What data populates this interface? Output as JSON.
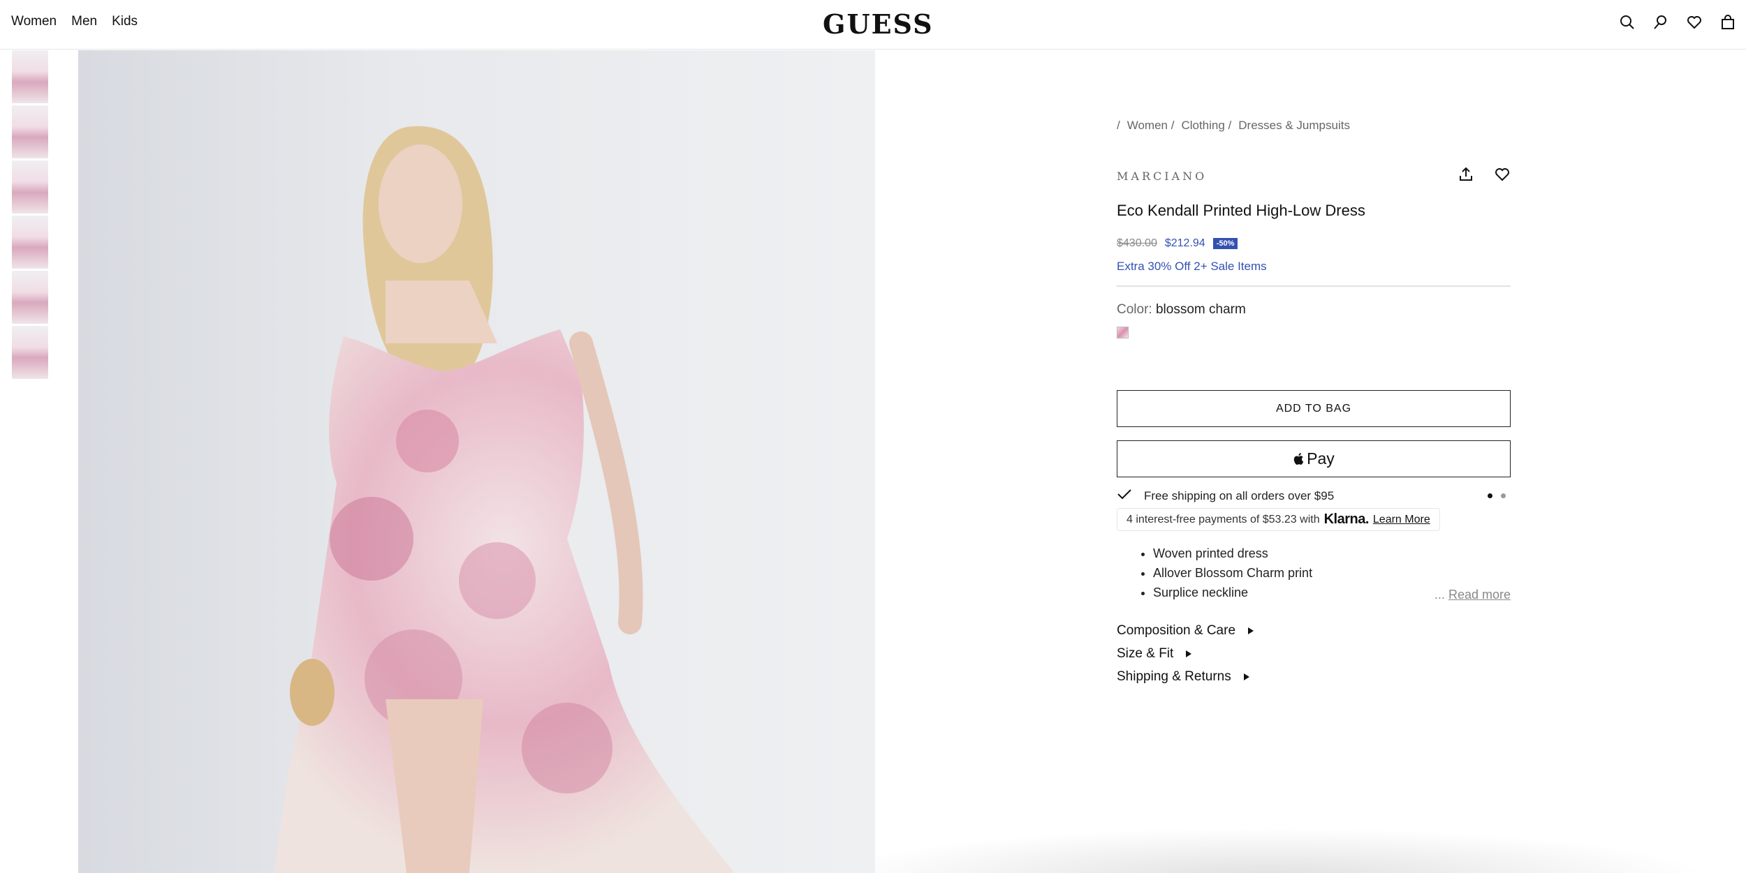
{
  "header": {
    "nav": [
      "Women",
      "Men",
      "Kids"
    ],
    "logo": "GUESS",
    "icons": [
      "search-icon",
      "account-icon",
      "wishlist-icon",
      "bag-icon"
    ]
  },
  "gallery": {
    "thumbnail_count": 6
  },
  "breadcrumb": {
    "sep": "/",
    "items": [
      "Women /",
      "Clothing /",
      "Dresses & Jumpsuits"
    ]
  },
  "product": {
    "brand": "MARCIANO",
    "title": "Eco Kendall Printed High-Low Dress",
    "original_price": "$430.00",
    "sale_price": "$212.94",
    "discount": "-50%",
    "promo": "Extra 30% Off 2+ Sale Items",
    "color_label": "Color:",
    "color_value": "blossom charm",
    "add_to_bag": "ADD TO BAG",
    "apple_pay": "Pay",
    "shipping": "Free shipping on all orders over $95",
    "klarna_text": "4 interest-free payments of $53.23 with",
    "klarna_brand": "Klarna.",
    "klarna_link": "Learn More",
    "features": [
      "Woven printed dress",
      "Allover Blossom Charm print",
      "Surplice neckline"
    ],
    "read_more_prefix": "...",
    "read_more": "Read more",
    "accordions": [
      "Composition & Care",
      "Size & Fit",
      "Shipping & Returns"
    ]
  },
  "colors": {
    "accent": "#3451b2",
    "text": "#111111"
  }
}
